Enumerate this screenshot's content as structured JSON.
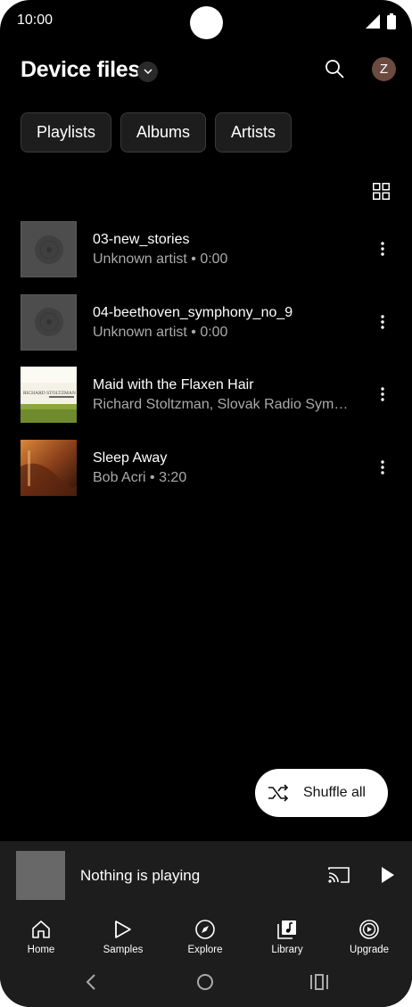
{
  "status_bar": {
    "time": "10:00"
  },
  "header": {
    "title": "Device files",
    "avatar_letter": "Z"
  },
  "chips": [
    {
      "label": "Playlists"
    },
    {
      "label": "Albums"
    },
    {
      "label": "Artists"
    }
  ],
  "tracks": [
    {
      "title": "03-new_stories",
      "subtitle": "Unknown artist • 0:00",
      "art": "generic-disc"
    },
    {
      "title": "04-beethoven_symphony_no_9",
      "subtitle": "Unknown artist • 0:00",
      "art": "generic-disc"
    },
    {
      "title": "Maid with the Flaxen Hair",
      "subtitle": "Richard Stoltzman, Slovak Radio Symphony Orchestra",
      "art": "album-cover-stoltzman",
      "art_text": "RICHARD STOLTZMAN"
    },
    {
      "title": "Sleep Away",
      "subtitle": "Bob Acri • 3:20",
      "art": "album-cover-sleep-away"
    }
  ],
  "shuffle": {
    "label": "Shuffle all"
  },
  "mini_player": {
    "title": "Nothing is playing"
  },
  "bottom_nav": [
    {
      "label": "Home",
      "icon": "home-icon"
    },
    {
      "label": "Samples",
      "icon": "samples-icon"
    },
    {
      "label": "Explore",
      "icon": "compass-icon"
    },
    {
      "label": "Library",
      "icon": "library-icon"
    },
    {
      "label": "Upgrade",
      "icon": "upgrade-icon"
    }
  ],
  "colors": {
    "background": "#000000",
    "surface": "#1d1d1d",
    "chip": "#1d1d1d",
    "avatar": "#6b4a40",
    "secondary_text": "#aaaaaa"
  }
}
